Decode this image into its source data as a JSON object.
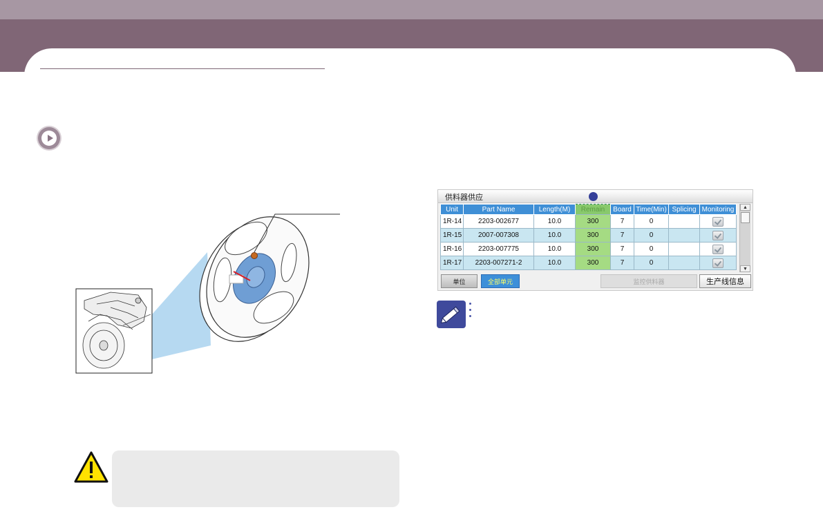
{
  "feeder_panel": {
    "title": "供料器供应",
    "columns": [
      "Unit",
      "Part Name",
      "Length(M)",
      "Remain",
      "Board",
      "Time(Min)",
      "Splicing",
      "Monitoring"
    ],
    "rows": [
      {
        "unit": "1R-14",
        "part_name": "2203-002677",
        "length": "10.0",
        "remain": "300",
        "board": "7",
        "time": "0",
        "splicing": "",
        "monitoring": true
      },
      {
        "unit": "1R-15",
        "part_name": "2007-007308",
        "length": "10.0",
        "remain": "300",
        "board": "7",
        "time": "0",
        "splicing": "",
        "monitoring": true
      },
      {
        "unit": "1R-16",
        "part_name": "2203-007775",
        "length": "10.0",
        "remain": "300",
        "board": "7",
        "time": "0",
        "splicing": "",
        "monitoring": true
      },
      {
        "unit": "1R-17",
        "part_name": "2203-007271-2",
        "length": "10.0",
        "remain": "300",
        "board": "7",
        "time": "0",
        "splicing": "",
        "monitoring": true
      }
    ],
    "buttons": {
      "unit": "单位",
      "all_units": "全部单元",
      "monitor_feeder": "监控供料器",
      "production_info": "生产线信息"
    }
  },
  "icons": {
    "play": "play-circle-icon",
    "warning": "warning-triangle-icon",
    "note": "note-pencil-icon"
  },
  "colors": {
    "header_band": "#806676",
    "header_band_light": "#a797a3",
    "table_header": "#3f8fd6",
    "remain_highlight": "#a5db83",
    "callout_dot": "#353f99"
  }
}
